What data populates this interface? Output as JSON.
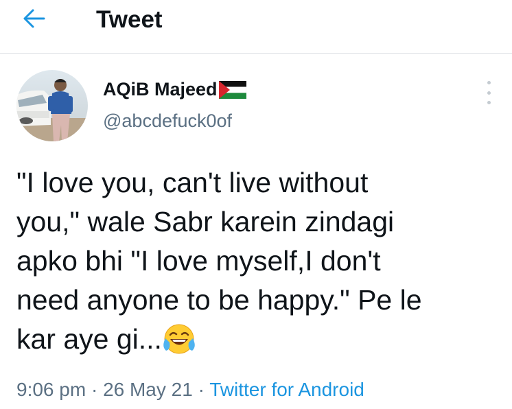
{
  "header": {
    "title": "Tweet",
    "back_icon": "arrow-left-icon"
  },
  "author": {
    "display_name": "AQiB Majeed",
    "flag_icon": "palestine-flag-icon",
    "handle": "@abcdefuck0of"
  },
  "tweet": {
    "text": "\"I love you, can't live without\nyou,\" wale Sabr karein zindagi\napko bhi \"I love myself,I don't\nneed anyone to be happy.\" Pe le\nkar aye gi...",
    "emoji_icon": "tears-of-joy-emoji-icon"
  },
  "meta": {
    "time": "9:06 pm",
    "separator1": " · ",
    "date": "26 May 21",
    "separator2": " · ",
    "source": "Twitter for Android"
  },
  "colors": {
    "accent": "#1b95e0",
    "text": "#0f1419",
    "secondary": "#5b7083",
    "divider": "#d9dde1"
  }
}
